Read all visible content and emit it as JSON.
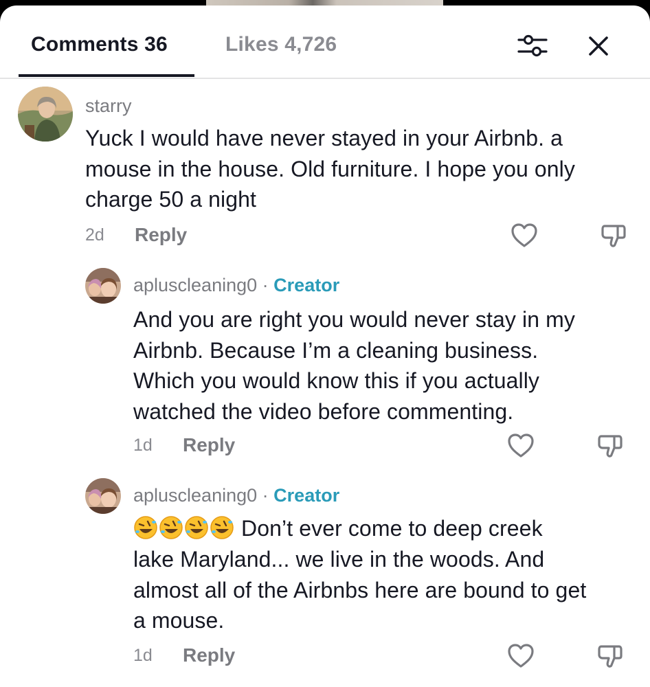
{
  "header": {
    "tabs": [
      {
        "label": "Comments 36",
        "active": true
      },
      {
        "label": "Likes 4,726",
        "active": false
      }
    ],
    "icons": [
      "filter-icon",
      "close-icon"
    ]
  },
  "comments": [
    {
      "username": "starry",
      "text": "Yuck I would have never stayed in your Airbnb. a\nmouse in the house. Old furniture. I hope you only\ncharge 50 a night",
      "time": "2d",
      "reply_label": "Reply",
      "creator": false
    },
    {
      "username": "apluscleaning0",
      "creator_badge": "Creator",
      "separator": "·",
      "text": "And you are right you would never stay in my\nAirbnb. Because I’m a cleaning business.\nWhich you would know this if you actually\nwatched the video before commenting.",
      "time": "1d",
      "reply_label": "Reply",
      "creator": true
    },
    {
      "username": "apluscleaning0",
      "creator_badge": "Creator",
      "separator": "·",
      "emoji": "🤣🤣🤣🤣",
      "text_line1": "Don’t ever come to deep creek",
      "text": "lake Maryland... we live in the woods. And\nalmost all of the Airbnbs here are bound to get\na mouse.",
      "time": "1d",
      "reply_label": "Reply",
      "creator": true
    }
  ],
  "colors": {
    "accent_creator": "#2a9bb8",
    "text_primary": "#161823",
    "text_secondary": "#7a7b80"
  }
}
